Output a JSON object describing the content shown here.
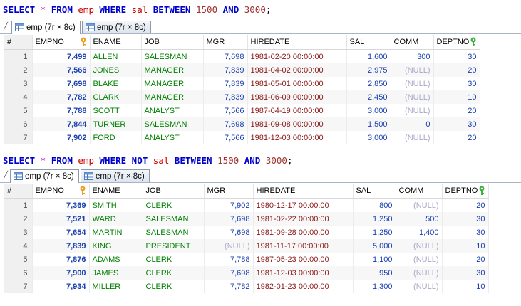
{
  "query1": {
    "parts": [
      {
        "t": "SELECT",
        "c": "kw"
      },
      {
        "t": " "
      },
      {
        "t": "*",
        "c": "op"
      },
      {
        "t": " "
      },
      {
        "t": "FROM",
        "c": "kw"
      },
      {
        "t": " "
      },
      {
        "t": "emp",
        "c": "tbl"
      },
      {
        "t": " "
      },
      {
        "t": "WHERE",
        "c": "kw"
      },
      {
        "t": " "
      },
      {
        "t": "sal",
        "c": "id"
      },
      {
        "t": " "
      },
      {
        "t": "BETWEEN",
        "c": "kw"
      },
      {
        "t": " "
      },
      {
        "t": "1500",
        "c": "num"
      },
      {
        "t": " "
      },
      {
        "t": "AND",
        "c": "kw"
      },
      {
        "t": " "
      },
      {
        "t": "3000",
        "c": "num"
      },
      {
        "t": ";"
      }
    ]
  },
  "query2": {
    "parts": [
      {
        "t": "SELECT",
        "c": "kw"
      },
      {
        "t": " "
      },
      {
        "t": "*",
        "c": "op"
      },
      {
        "t": " "
      },
      {
        "t": "FROM",
        "c": "kw"
      },
      {
        "t": " "
      },
      {
        "t": "emp",
        "c": "tbl"
      },
      {
        "t": " "
      },
      {
        "t": "WHERE",
        "c": "kw"
      },
      {
        "t": " "
      },
      {
        "t": "NOT",
        "c": "kw"
      },
      {
        "t": " "
      },
      {
        "t": "sal",
        "c": "id"
      },
      {
        "t": " "
      },
      {
        "t": "BETWEEN",
        "c": "kw"
      },
      {
        "t": " "
      },
      {
        "t": "1500",
        "c": "num"
      },
      {
        "t": " "
      },
      {
        "t": "AND",
        "c": "kw"
      },
      {
        "t": " "
      },
      {
        "t": "3000",
        "c": "num"
      },
      {
        "t": ";"
      }
    ]
  },
  "tabs1": [
    {
      "label": "emp (7r × 8c)"
    },
    {
      "label": "emp (7r × 8c)"
    }
  ],
  "tabs2": [
    {
      "label": "emp (7r × 8c)"
    },
    {
      "label": "emp (7r × 8c)"
    }
  ],
  "grid_marker": "#",
  "columns": [
    "EMPNO",
    "ENAME",
    "JOB",
    "MGR",
    "HIREDATE",
    "SAL",
    "COMM",
    "DEPTNO"
  ],
  "null_text": "(NULL)",
  "rows1": [
    [
      "1",
      "7,499",
      "ALLEN",
      "SALESMAN",
      "7,698",
      "1981-02-20 00:00:00",
      "1,600",
      "300",
      "30"
    ],
    [
      "2",
      "7,566",
      "JONES",
      "MANAGER",
      "7,839",
      "1981-04-02 00:00:00",
      "2,975",
      "(NULL)",
      "20"
    ],
    [
      "3",
      "7,698",
      "BLAKE",
      "MANAGER",
      "7,839",
      "1981-05-01 00:00:00",
      "2,850",
      "(NULL)",
      "30"
    ],
    [
      "4",
      "7,782",
      "CLARK",
      "MANAGER",
      "7,839",
      "1981-06-09 00:00:00",
      "2,450",
      "(NULL)",
      "10"
    ],
    [
      "5",
      "7,788",
      "SCOTT",
      "ANALYST",
      "7,566",
      "1987-04-19 00:00:00",
      "3,000",
      "(NULL)",
      "20"
    ],
    [
      "6",
      "7,844",
      "TURNER",
      "SALESMAN",
      "7,698",
      "1981-09-08 00:00:00",
      "1,500",
      "0",
      "30"
    ],
    [
      "7",
      "7,902",
      "FORD",
      "ANALYST",
      "7,566",
      "1981-12-03 00:00:00",
      "3,000",
      "(NULL)",
      "20"
    ]
  ],
  "rows2": [
    [
      "1",
      "7,369",
      "SMITH",
      "CLERK",
      "7,902",
      "1980-12-17 00:00:00",
      "800",
      "(NULL)",
      "20"
    ],
    [
      "2",
      "7,521",
      "WARD",
      "SALESMAN",
      "7,698",
      "1981-02-22 00:00:00",
      "1,250",
      "500",
      "30"
    ],
    [
      "3",
      "7,654",
      "MARTIN",
      "SALESMAN",
      "7,698",
      "1981-09-28 00:00:00",
      "1,250",
      "1,400",
      "30"
    ],
    [
      "4",
      "7,839",
      "KING",
      "PRESIDENT",
      "(NULL)",
      "1981-11-17 00:00:00",
      "5,000",
      "(NULL)",
      "10"
    ],
    [
      "5",
      "7,876",
      "ADAMS",
      "CLERK",
      "7,788",
      "1987-05-23 00:00:00",
      "1,100",
      "(NULL)",
      "20"
    ],
    [
      "6",
      "7,900",
      "JAMES",
      "CLERK",
      "7,698",
      "1981-12-03 00:00:00",
      "950",
      "(NULL)",
      "30"
    ],
    [
      "7",
      "7,934",
      "MILLER",
      "CLERK",
      "7,782",
      "1982-01-23 00:00:00",
      "1,300",
      "(NULL)",
      "10"
    ]
  ],
  "colors": {
    "keyword": "#0000cc",
    "empno": "#1a3fb0",
    "name": "#008000",
    "date": "#8b1a1a",
    "null": "#a9aac8",
    "primary_key": "#f0a020",
    "foreign_key": "#3cb43c"
  }
}
